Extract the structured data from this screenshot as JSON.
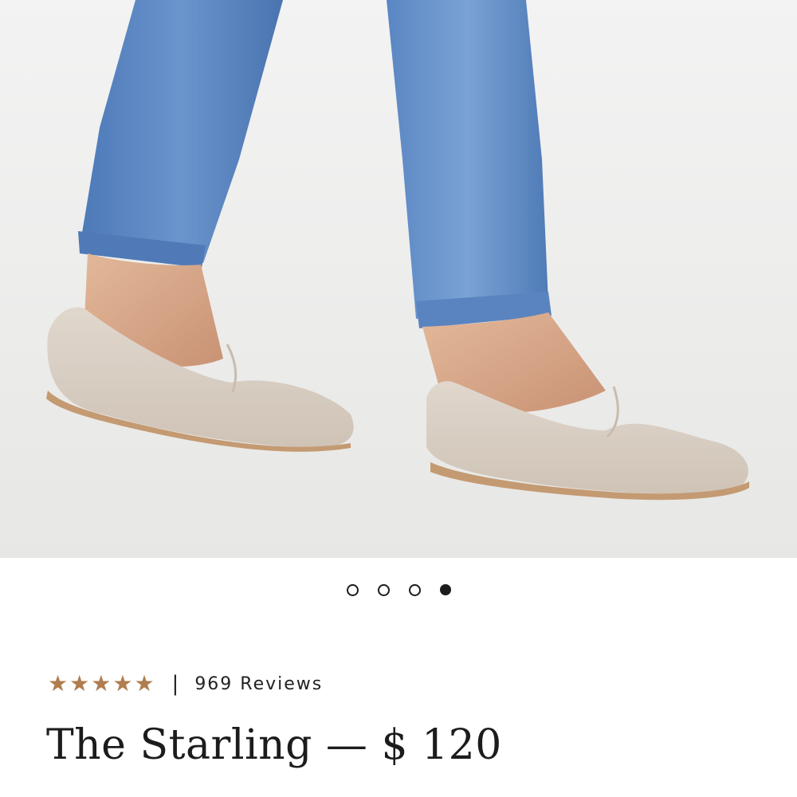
{
  "carousel": {
    "slide_count": 4,
    "active_index": 3
  },
  "rating": {
    "stars": 5,
    "star_icon": "star-icon",
    "separator": "|",
    "reviews_text": "969 Reviews"
  },
  "product": {
    "title": "The Starling — $ 120"
  },
  "colors": {
    "star": "#b07d4f",
    "text": "#1c1c1c",
    "background": "#ffffff",
    "denim": "#5b86c2",
    "suede": "#d8cec4",
    "sole": "#c49a72"
  }
}
